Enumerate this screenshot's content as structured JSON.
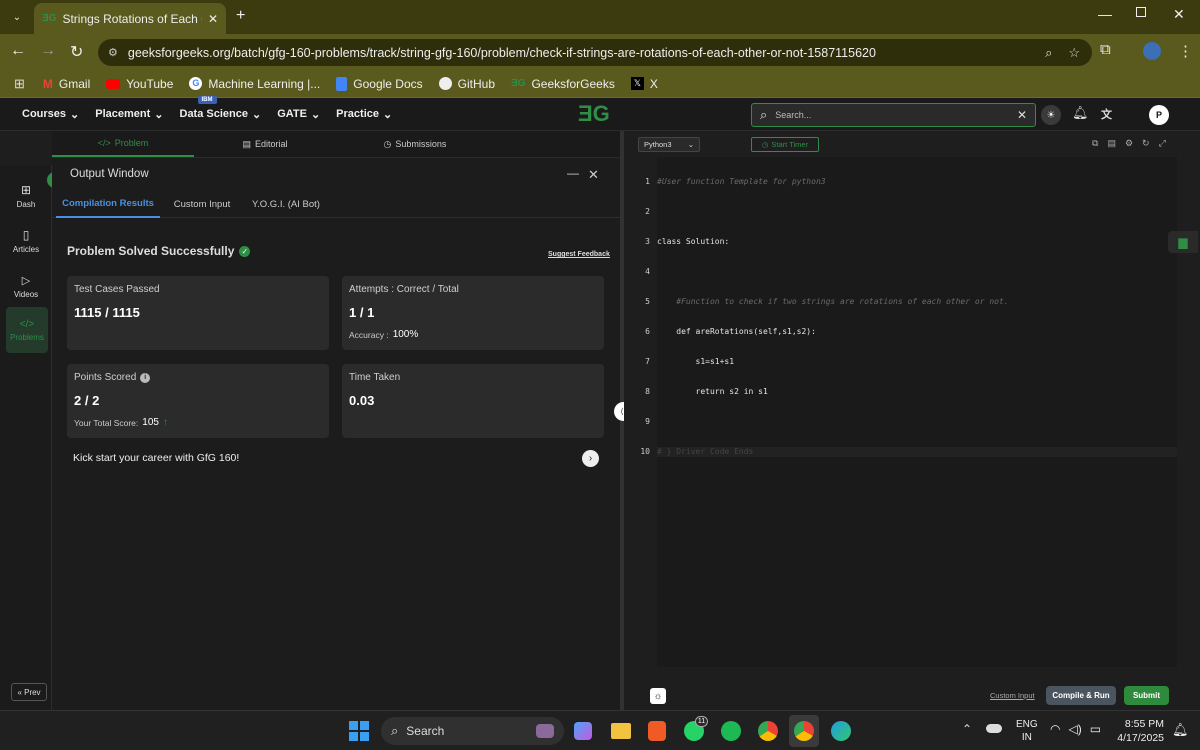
{
  "browser": {
    "tab_title": "Strings Rotations of Each Other",
    "url": "geeksforgeeks.org/batch/gfg-160-problems/track/string-gfg-160/problem/check-if-strings-are-rotations-of-each-other-or-not-1587115620",
    "bookmarks": [
      "Gmail",
      "YouTube",
      "Machine Learning |...",
      "Google Docs",
      "GitHub",
      "GeeksforGeeks",
      "X"
    ]
  },
  "gfg_nav": {
    "logo": "ƎG",
    "items": [
      "Courses",
      "Placement",
      "Data Science",
      "GATE",
      "Practice"
    ],
    "ibm_badge": "IBM",
    "search_placeholder": "Search...",
    "avatar_initial": "P"
  },
  "left_rail": {
    "items": [
      "Dash",
      "Articles",
      "Videos",
      "Problems"
    ],
    "prev_label": "« Prev"
  },
  "problem_tabs": [
    "Problem",
    "Editorial",
    "Submissions"
  ],
  "output": {
    "title": "Output Window",
    "tabs": [
      "Compilation Results",
      "Custom Input",
      "Y.O.G.I. (AI Bot)"
    ],
    "status": "Problem Solved Successfully",
    "suggest_feedback": "Suggest Feedback",
    "test_cases_label": "Test Cases Passed",
    "test_cases_value": "1115 / 1115",
    "attempts_label": "Attempts : Correct / Total",
    "attempts_value": "1 / 1",
    "accuracy_label": "Accuracy :",
    "accuracy_value": "100%",
    "points_label": "Points Scored",
    "points_value": "2 / 2",
    "total_score_label": "Your Total Score:",
    "total_score_value": "105",
    "time_label": "Time Taken",
    "time_value": "0.03",
    "promo": "Kick start your career with GfG 160!"
  },
  "editor": {
    "language": "Python3",
    "start_timer": "Start Timer",
    "line_numbers": [
      "1",
      "2",
      "3",
      "4",
      "5",
      "6",
      "7",
      "8",
      "9",
      "10"
    ],
    "code_lines": [
      "#User function Template for python3",
      "",
      "class Solution:",
      "",
      "    #Function to check if two strings are rotations of each other or not.",
      "    def areRotations(self,s1,s2):",
      "        s1=s1+s1",
      "        return s2 in s1",
      "",
      "# } Driver Code Ends"
    ],
    "custom_input": "Custom Input",
    "compile_run": "Compile & Run",
    "submit": "Submit"
  },
  "taskbar": {
    "search_label": "Search",
    "whatsapp_badge": "11",
    "lang_line1": "ENG",
    "lang_line2": "IN",
    "time": "8:55 PM",
    "date": "4/17/2025"
  },
  "colors": {
    "gfg_green": "#2f8d46",
    "accent_blue": "#4a90e2",
    "submit_green": "#2e8b3d",
    "chrome_olive": "#5a5a1e"
  }
}
